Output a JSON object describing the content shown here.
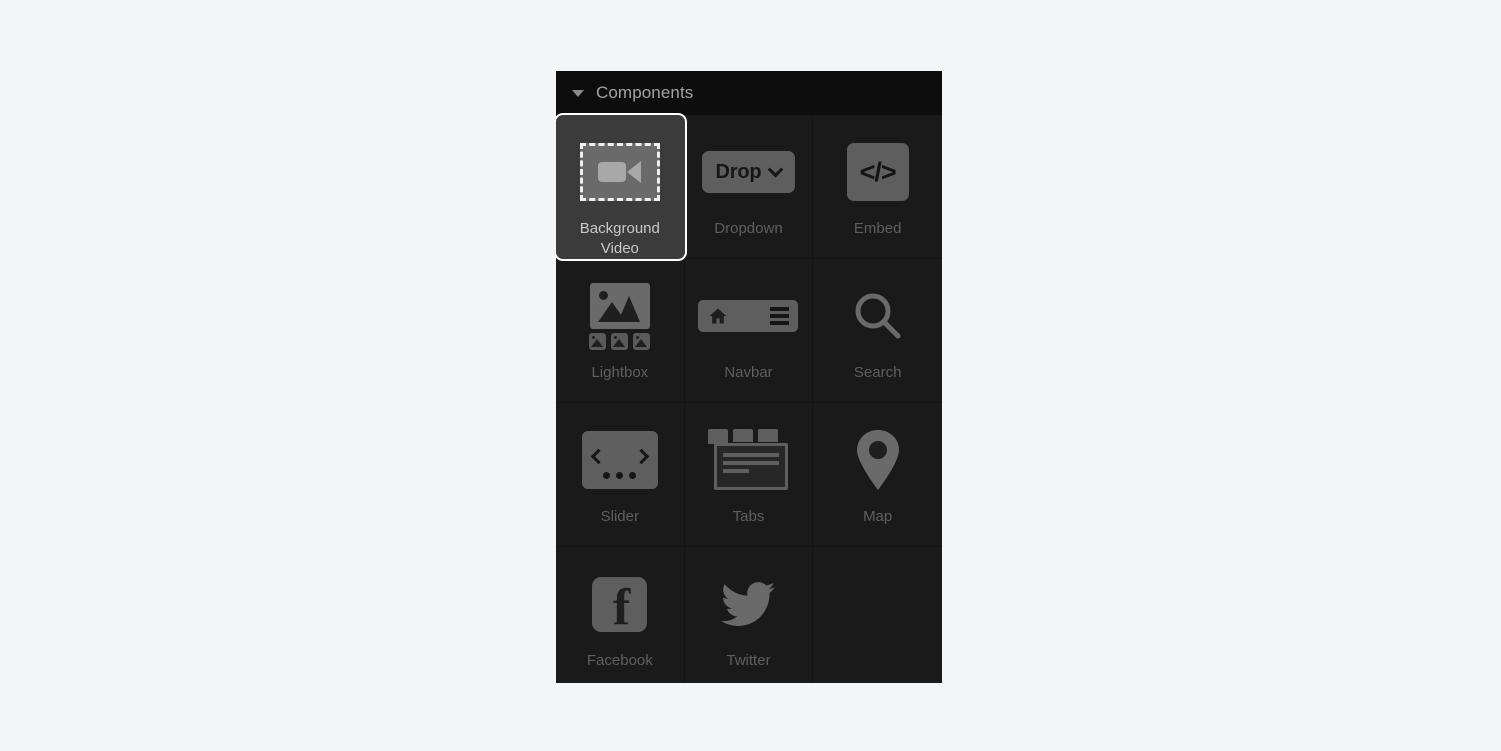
{
  "page": {
    "background_color": "#f4f5f7"
  },
  "panel": {
    "background_color": "#1a1a1a",
    "header": {
      "title": "Components",
      "collapse_icon": "caret-down-icon",
      "background_color": "#0d0d0d",
      "text_color": "#a3a3a3"
    },
    "selection": {
      "selected_index": 0,
      "selected_label": "Background Video",
      "outline_color": "#ffffff",
      "tile_background_color": "#3b3b3b"
    },
    "grid": {
      "columns": 3,
      "label_color": "#5f5f5f",
      "icon_color": "#6a6a6a",
      "items": [
        {
          "label": "Background Video",
          "icon": "background-video-icon",
          "selected": true
        },
        {
          "label": "Dropdown",
          "icon": "dropdown-icon",
          "icon_text": "Drop",
          "selected": false
        },
        {
          "label": "Embed",
          "icon": "code-embed-icon",
          "icon_text": "</>",
          "selected": false
        },
        {
          "label": "Lightbox",
          "icon": "lightbox-icon",
          "selected": false
        },
        {
          "label": "Navbar",
          "icon": "navbar-icon",
          "selected": false
        },
        {
          "label": "Search",
          "icon": "search-icon",
          "selected": false
        },
        {
          "label": "Slider",
          "icon": "slider-icon",
          "selected": false
        },
        {
          "label": "Tabs",
          "icon": "tabs-icon",
          "selected": false
        },
        {
          "label": "Map",
          "icon": "map-pin-icon",
          "selected": false
        },
        {
          "label": "Facebook",
          "icon": "facebook-icon",
          "selected": false
        },
        {
          "label": "Twitter",
          "icon": "twitter-icon",
          "selected": false
        },
        {
          "label": "",
          "icon": "",
          "selected": false
        }
      ]
    }
  }
}
